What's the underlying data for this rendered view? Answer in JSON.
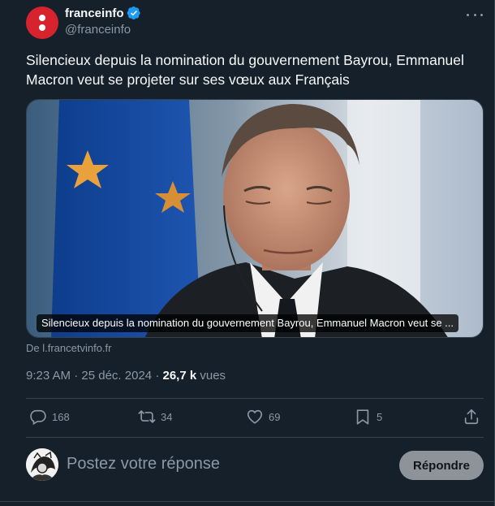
{
  "author": {
    "name": "franceinfo",
    "handle": "@franceinfo",
    "verified": true
  },
  "tweet": {
    "text": "Silencieux depuis la nomination du gouvernement Bayrou, Emmanuel Macron veut se projeter sur ses vœux aux Français"
  },
  "card": {
    "caption": "Silencieux depuis la nomination du gouvernement Bayrou, Emmanuel Macron veut se ...",
    "source": "De l.francetvinfo.fr",
    "image_icon": "photo-macron"
  },
  "meta": {
    "time": "9:23 AM",
    "separator": " · ",
    "date": "25 déc. 2024",
    "views_count": "26,7 k",
    "views_label": "vues"
  },
  "actions": {
    "replies": "168",
    "reposts": "34",
    "likes": "69",
    "bookmarks": "5"
  },
  "reply": {
    "placeholder": "Postez votre réponse",
    "button_label": "Répondre"
  },
  "colors": {
    "background": "#15202b",
    "brand_red": "#d7232e",
    "verified_blue": "#1d9bf0",
    "muted_text": "#8b98a5",
    "border": "#38444d"
  }
}
